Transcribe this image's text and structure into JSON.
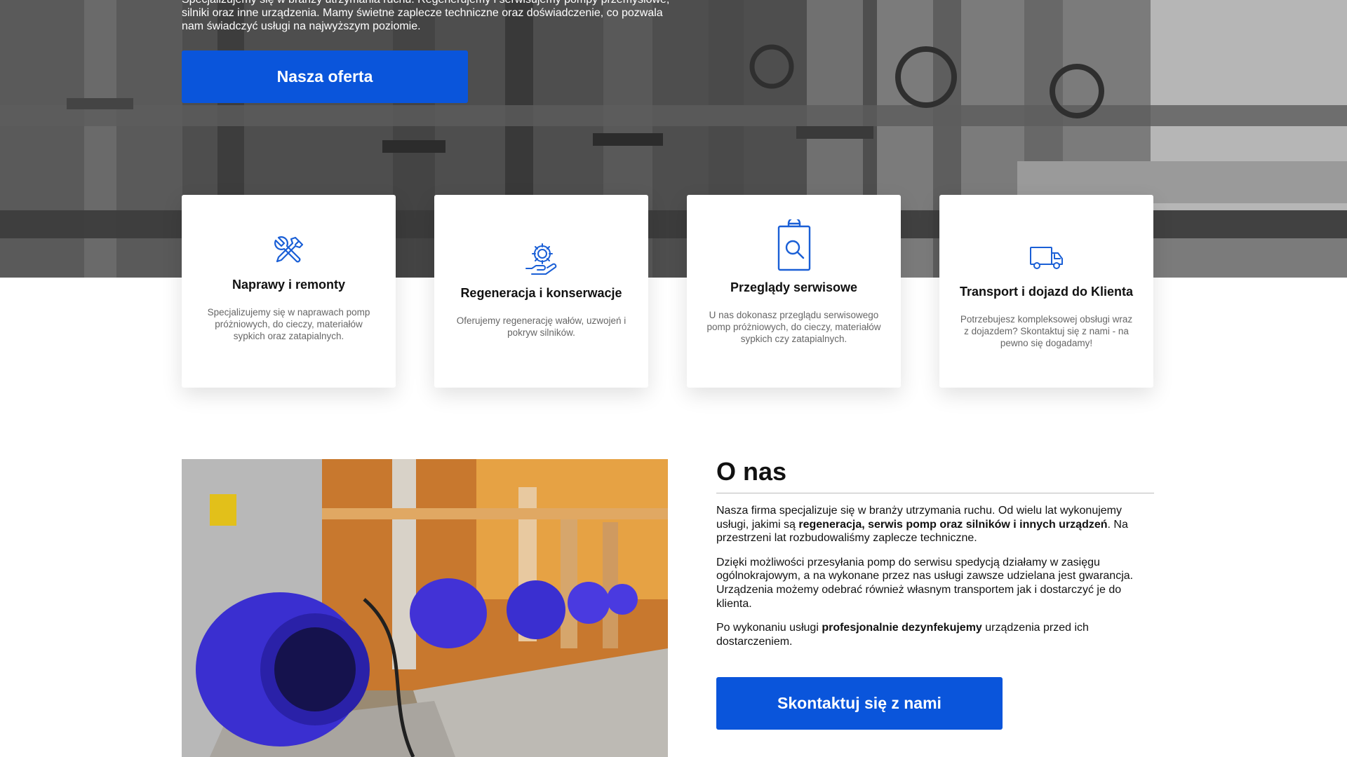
{
  "hero": {
    "line1": "Specjalizujemy się w branży utrzymania ruchu. Regenerujemy i serwisujemy pompy przemysłowe,",
    "line2": "silniki oraz inne urządzenia. Mamy świetne zaplecze techniczne oraz doświadczenie, co pozwala",
    "line3": "nam świadczyć usługi na najwyższym poziomie.",
    "button_label": "Nasza oferta"
  },
  "cards": [
    {
      "icon": "tools-icon",
      "title": "Naprawy i remonty",
      "text": "Specjalizujemy się w naprawach pomp próżniowych, do cieczy, materiałów sypkich oraz zatapialnych."
    },
    {
      "icon": "gear-hand-icon",
      "title": "Regeneracja i konserwacje",
      "text": "Oferujemy regenerację wałów, uzwojeń i pokryw silników."
    },
    {
      "icon": "clipboard-search-icon",
      "title": "Przeglądy serwisowe",
      "text": "U nas dokonasz przeglądu serwisowego pomp próżniowych, do cieczy, materiałów sypkich czy zatapialnych."
    },
    {
      "icon": "truck-icon",
      "title": "Transport i dojazd do Klienta",
      "text": "Potrzebujesz kompleksowej obsługi wraz z dojazdem? Skontaktuj się z nami - na pewno się dogadamy!"
    }
  ],
  "about": {
    "title": "O nas",
    "p1_before": "Nasza firma specjalizuje się w branży utrzymania ruchu. Od wielu lat wykonujemy usługi, jakimi są ",
    "p1_bold": "regeneracja, serwis pomp oraz silników i innych urządzeń",
    "p1_after": ". Na przestrzeni lat rozbudowaliśmy zaplecze techniczne.",
    "p2": "Dzięki możliwości przesyłania pomp do serwisu spedycją działamy w zasięgu ogólnokrajowym, a na wykonane przez nas usługi zawsze udzielana jest gwarancja. Urządzenia możemy odebrać również własnym transportem jak i dostarczyć je do klienta.",
    "p3_before": "Po wykonaniu usługi ",
    "p3_bold": "profesjonalnie dezynfekujemy",
    "p3_after": " urządzenia przed ich dostarczeniem.",
    "button_label": "Skontaktuj się z nami"
  },
  "colors": {
    "accent": "#0a55db",
    "icon_blue": "#1a5fd6"
  }
}
